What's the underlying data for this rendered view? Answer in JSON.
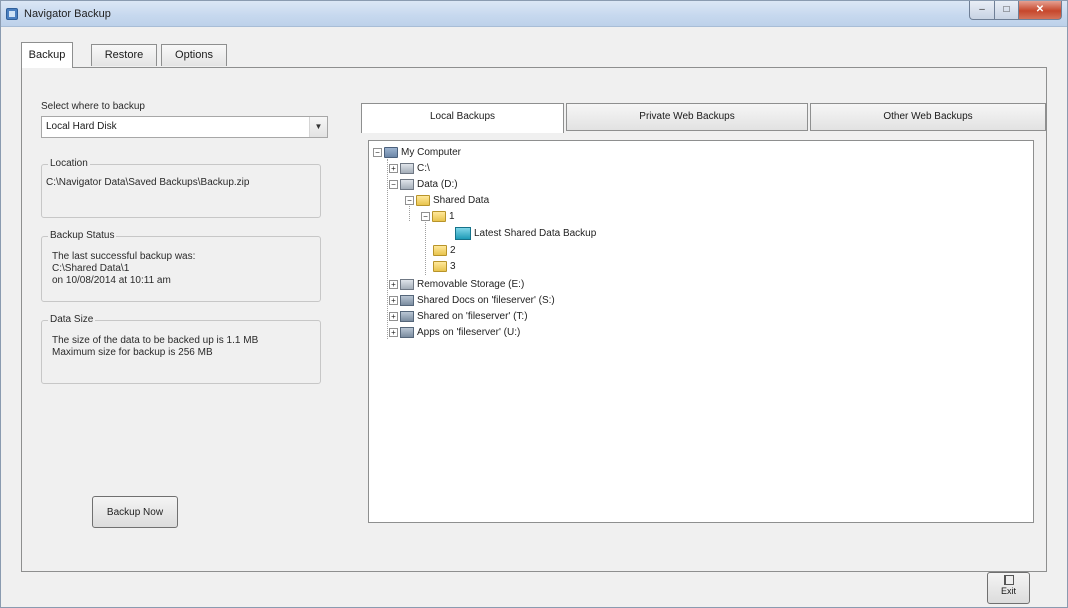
{
  "window": {
    "title": "Navigator Backup",
    "min_glyph": "–",
    "max_glyph": "□",
    "close_glyph": "✕"
  },
  "tabs": [
    {
      "label": "Backup"
    },
    {
      "label": "Restore"
    },
    {
      "label": "Options"
    }
  ],
  "backup_panel": {
    "select_label": "Select where to backup",
    "combo_value": "Local Hard Disk",
    "location_legend": "Location",
    "location_text": "C:\\Navigator Data\\Saved Backups\\Backup.zip",
    "status_legend": "Backup Status",
    "status_lines": [
      "The last successful backup was:",
      "C:\\Shared Data\\1",
      "on 10/08/2014 at 10:11 am"
    ],
    "size_legend": "Data Size",
    "size_lines": [
      "The size of the data to be backed up is 1.1 MB",
      "Maximum size for backup is 256 MB"
    ],
    "backup_now_label": "Backup Now"
  },
  "location_tabs": [
    {
      "label": "Local Backups"
    },
    {
      "label": "Private Web Backups"
    },
    {
      "label": "Other Web Backups"
    }
  ],
  "tree": {
    "root": "My Computer",
    "items": [
      {
        "label": "C:\\",
        "level": 1,
        "icon": "drive-icon"
      },
      {
        "label": "Data (D:)",
        "level": 1,
        "icon": "drive-icon"
      },
      {
        "label": "Shared Data",
        "level": 2,
        "icon": "folder-icon"
      },
      {
        "label": "1",
        "level": 3,
        "icon": "folder-icon"
      },
      {
        "label": "Latest Shared Data Backup",
        "level": 4,
        "icon": "backup-icon"
      },
      {
        "label": "2",
        "level": 3,
        "icon": "folder-icon"
      },
      {
        "label": "3",
        "level": 3,
        "icon": "folder-icon"
      },
      {
        "label": "Removable Storage (E:)",
        "level": 1,
        "icon": "drive-icon"
      },
      {
        "label": "Shared Docs on 'fileserver' (S:)",
        "level": 1,
        "icon": "net-drive-icon"
      },
      {
        "label": "Shared on 'fileserver' (T:)",
        "level": 1,
        "icon": "net-drive-icon"
      },
      {
        "label": "Apps on 'fileserver' (U:)",
        "level": 1,
        "icon": "net-drive-icon"
      }
    ]
  },
  "exit_label": "Exit"
}
